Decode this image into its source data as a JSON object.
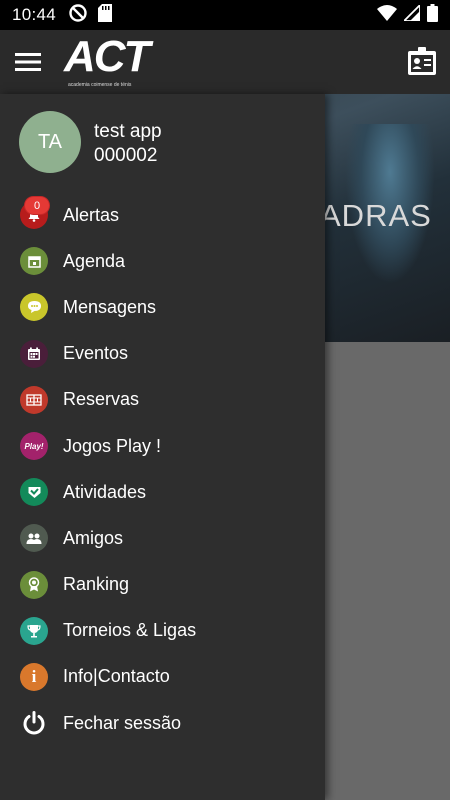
{
  "status_bar": {
    "time": "10:44",
    "left_icons": [
      "data-saver-icon",
      "sd-card-icon"
    ],
    "right_icons": [
      "wifi-icon",
      "signal-icon",
      "battery-icon"
    ]
  },
  "app_bar": {
    "logo_text": "ACT",
    "logo_subtext": "academia coimense de ténis",
    "menu_icon": "hamburger-menu-icon",
    "profile_icon": "profile-card-icon"
  },
  "background": {
    "hero_caption": "ADRAS"
  },
  "drawer": {
    "user": {
      "initials": "TA",
      "name": "test app",
      "id": "000002",
      "avatar_color": "#8fb08f"
    },
    "items": [
      {
        "label": "Alertas",
        "icon": "bell-icon",
        "color": "#b71c1c",
        "badge": "0"
      },
      {
        "label": "Agenda",
        "icon": "calendar-icon",
        "color": "#6b8e3a"
      },
      {
        "label": "Mensagens",
        "icon": "chat-bubble-icon",
        "color": "#c9c62b"
      },
      {
        "label": "Eventos",
        "icon": "event-icon",
        "color": "#4a1e3a"
      },
      {
        "label": "Reservas",
        "icon": "court-icon",
        "color": "#c0392b"
      },
      {
        "label": "Jogos Play !",
        "icon": "play-icon",
        "color": "#a3226b",
        "icon_text": "Play!"
      },
      {
        "label": "Atividades",
        "icon": "check-badge-icon",
        "color": "#138a5a"
      },
      {
        "label": "Amigos",
        "icon": "friends-icon",
        "color": "#505a50"
      },
      {
        "label": "Ranking",
        "icon": "medal-icon",
        "color": "#6b8e3a"
      },
      {
        "label": "Torneios & Ligas",
        "icon": "trophy-icon",
        "color": "#2aa58f"
      },
      {
        "label": "Info|Contacto",
        "icon": "info-icon",
        "color": "#d9782c",
        "icon_text": "i"
      },
      {
        "label": "Fechar sessão",
        "icon": "power-icon",
        "color": "transparent"
      }
    ]
  }
}
